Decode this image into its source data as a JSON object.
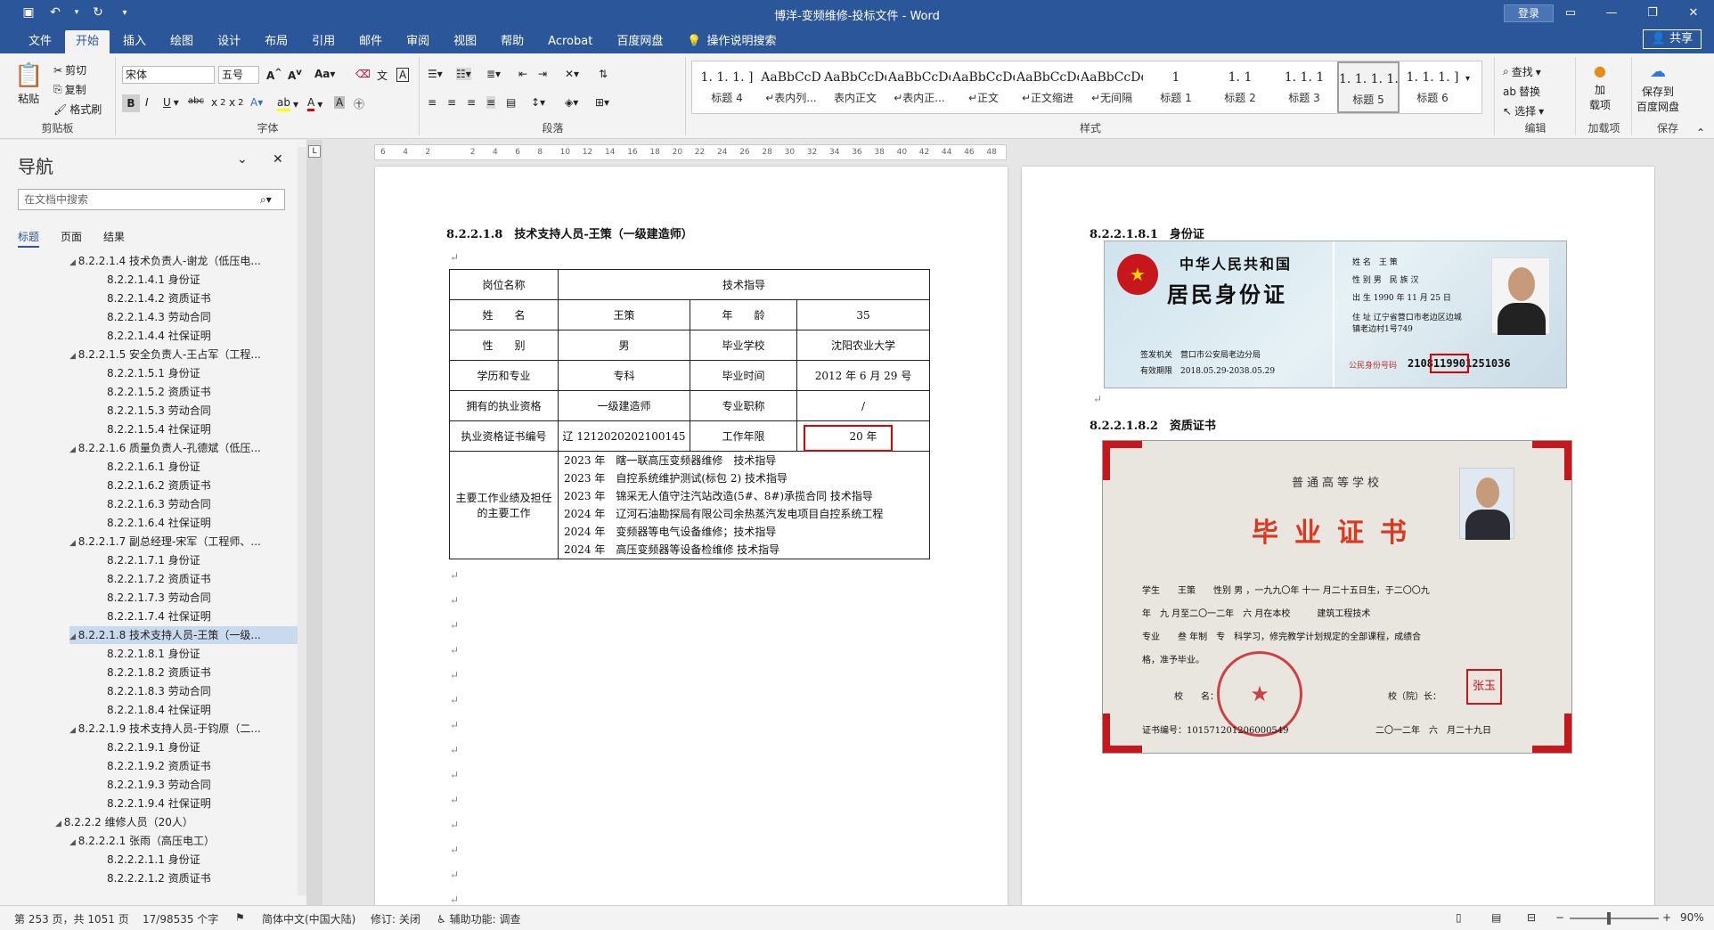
{
  "window": {
    "title": "博洋-变频维修-投标文件 - Word",
    "login": "登录",
    "share": "共享"
  },
  "tabs": [
    "文件",
    "开始",
    "插入",
    "绘图",
    "设计",
    "布局",
    "引用",
    "邮件",
    "审阅",
    "视图",
    "帮助",
    "Acrobat",
    "百度网盘",
    "操作说明搜索"
  ],
  "ribbon": {
    "clipboard": {
      "paste": "粘贴",
      "cut": "剪切",
      "copy": "复制",
      "painter": "格式刷",
      "label": "剪贴板"
    },
    "font": {
      "name": "宋体",
      "size": "五号",
      "label": "字体"
    },
    "paragraph": {
      "label": "段落"
    },
    "styles": {
      "label": "样式",
      "items": [
        {
          "preview": "1. 1. 1. ]",
          "name": "标题 4"
        },
        {
          "preview": "AaBbCcD",
          "name": "↵表内列..."
        },
        {
          "preview": "AaBbCcDdI",
          "name": "表内正文"
        },
        {
          "preview": "AaBbCcDdI",
          "name": "↵表内正..."
        },
        {
          "preview": "AaBbCcDdI",
          "name": "↵正文"
        },
        {
          "preview": "AaBbCcDdI",
          "name": "↵正文缩进"
        },
        {
          "preview": "AaBbCcDdI",
          "name": "↵无间隔"
        },
        {
          "preview": "1",
          "name": "标题 1"
        },
        {
          "preview": "Aa",
          "name": "标题 1"
        },
        {
          "preview": "1. 1",
          "name": "标题 2"
        },
        {
          "preview": "1. 1. 1",
          "name": "标题 3"
        },
        {
          "preview": "1. 1. 1. 1.",
          "name": "标题 5"
        },
        {
          "preview": "1. 1. 1. ]",
          "name": "标题 6"
        }
      ]
    },
    "editing": {
      "find": "查找",
      "replace": "替换",
      "select": "选择",
      "label": "编辑"
    },
    "addins": {
      "load": "加\n载项",
      "label": "加载项"
    },
    "baidu": {
      "save": "保存到\n百度网盘",
      "label": "保存"
    }
  },
  "nav": {
    "title": "导航",
    "search_placeholder": "在文档中搜索",
    "tabs": [
      "标题",
      "页面",
      "结果"
    ],
    "items": [
      {
        "text": "8.2.2.1.4 技术负责人-谢龙（低压电...",
        "level": 1,
        "arrow": true
      },
      {
        "text": "8.2.2.1.4.1 身份证",
        "level": 2
      },
      {
        "text": "8.2.2.1.4.2 资质证书",
        "level": 2
      },
      {
        "text": "8.2.2.1.4.3 劳动合同",
        "level": 2
      },
      {
        "text": "8.2.2.1.4.4 社保证明",
        "level": 2
      },
      {
        "text": "8.2.2.1.5 安全负责人-王占军（工程...",
        "level": 1,
        "arrow": true
      },
      {
        "text": "8.2.2.1.5.1 身份证",
        "level": 2
      },
      {
        "text": "8.2.2.1.5.2 资质证书",
        "level": 2
      },
      {
        "text": "8.2.2.1.5.3 劳动合同",
        "level": 2
      },
      {
        "text": "8.2.2.1.5.4 社保证明",
        "level": 2
      },
      {
        "text": "8.2.2.1.6 质量负责人-孔德斌（低压...",
        "level": 1,
        "arrow": true
      },
      {
        "text": "8.2.2.1.6.1 身份证",
        "level": 2
      },
      {
        "text": "8.2.2.1.6.2 资质证书",
        "level": 2
      },
      {
        "text": "8.2.2.1.6.3 劳动合同",
        "level": 2
      },
      {
        "text": "8.2.2.1.6.4 社保证明",
        "level": 2
      },
      {
        "text": "8.2.2.1.7 副总经理-宋军（工程师、...",
        "level": 1,
        "arrow": true
      },
      {
        "text": "8.2.2.1.7.1 身份证",
        "level": 2
      },
      {
        "text": "8.2.2.1.7.2 资质证书",
        "level": 2
      },
      {
        "text": "8.2.2.1.7.3 劳动合同",
        "level": 2
      },
      {
        "text": "8.2.2.1.7.4 社保证明",
        "level": 2
      },
      {
        "text": "8.2.2.1.8 技术支持人员-王策（一级...",
        "level": 1,
        "arrow": true,
        "selected": true
      },
      {
        "text": "8.2.2.1.8.1 身份证",
        "level": 2
      },
      {
        "text": "8.2.2.1.8.2 资质证书",
        "level": 2
      },
      {
        "text": "8.2.2.1.8.3 劳动合同",
        "level": 2
      },
      {
        "text": "8.2.2.1.8.4 社保证明",
        "level": 2
      },
      {
        "text": "8.2.2.1.9 技术支持人员-于钧原（二...",
        "level": 1,
        "arrow": true
      },
      {
        "text": "8.2.2.1.9.1 身份证",
        "level": 2
      },
      {
        "text": "8.2.2.1.9.2 资质证书",
        "level": 2
      },
      {
        "text": "8.2.2.1.9.3 劳动合同",
        "level": 2
      },
      {
        "text": "8.2.2.1.9.4 社保证明",
        "level": 2
      },
      {
        "text": "8.2.2.2 维修人员（20人）",
        "level": 0,
        "arrow": true
      },
      {
        "text": "8.2.2.2.1 张雨（高压电工）",
        "level": 1,
        "arrow": true
      },
      {
        "text": "8.2.2.2.1.1 身份证",
        "level": 2
      },
      {
        "text": "8.2.2.2.1.2 资质证书",
        "level": 2
      }
    ]
  },
  "ruler": {
    "ticks": [
      "6",
      "4",
      "2",
      "",
      "2",
      "4",
      "6",
      "8",
      "10",
      "12",
      "14",
      "16",
      "18",
      "20",
      "22",
      "24",
      "26",
      "28",
      "30",
      "32",
      "34",
      "36",
      "38",
      "40",
      "42",
      "44",
      "46",
      "48"
    ]
  },
  "page1": {
    "heading": "8.2.2.1.8　技术支持人员-王策（一级建造师）",
    "table": {
      "r1": [
        "岗位名称",
        "技术指导"
      ],
      "r2": [
        "姓　　名",
        "王策",
        "年　　龄",
        "35"
      ],
      "r3": [
        "性　　别",
        "男",
        "毕业学校",
        "沈阳农业大学"
      ],
      "r4": [
        "学历和专业",
        "专科",
        "毕业时间",
        "2012 年 6 月 29 号"
      ],
      "r5": [
        "拥有的执业资格",
        "一级建造师",
        "专业职称",
        "/"
      ],
      "r6": [
        "执业资格证书编号",
        "辽 1212020202100145",
        "工作年限",
        "20 年"
      ],
      "r7label": "主要工作业绩及担任的主要工作",
      "work": [
        "2023 年　瞎一联高压变频器维修　技术指导",
        "2023 年　自控系统维护测试(标包 2)  技术指导",
        "2023 年　锦采无人值守注汽站改造(5#、8#)承揽合同  技术指导",
        "2024 年　辽河石油勘探局有限公司余热蒸汽发电项目自控系统工程",
        "2024 年　变频器等电气设备维修；技术指导",
        "2024 年　高压变频器等设备检维修  技术指导"
      ]
    }
  },
  "page2": {
    "heading1": "8.2.2.1.8.1　身份证",
    "heading2": "8.2.2.1.8.2　资质证书",
    "idcard": {
      "front_title1": "中华人民共和国",
      "front_title2": "居民身份证",
      "authority_label": "签发机关",
      "authority": "营口市公安局老边分局",
      "valid_label": "有效期限",
      "valid": "2018.05.29-2038.05.29",
      "name_label": "姓 名",
      "name": "王 策",
      "sex_label": "性 别",
      "sex": "男",
      "nation_label": "民 族",
      "nation": "汉",
      "birth_label": "出 生",
      "birth": "1990 年 11 月 25 日",
      "addr_label": "住 址",
      "addr": "辽宁省营口市老边区边城镇老边村1号749",
      "id_label": "公民身份号码",
      "id_pre": "2108",
      "id_mid": "11990",
      "id_post": "1251036"
    },
    "cert": {
      "school": "普通高等学校",
      "title": "毕业证书",
      "line1": "学生　　王策　　性别 男 ，一九九〇年 十一 月二十五日生，于二〇〇九",
      "line2": "年　九 月至二〇一二年　六 月在本校　　　建筑工程技术",
      "line3": "专业　　叁 年制　专　科学习，修完教学计划规定的全部课程，成绩合",
      "line4": "格，准予毕业。",
      "head_label": "校　　名：",
      "president_label": "校（院）长：",
      "seal": "张玉",
      "no_label": "证书编号：",
      "no": "101571201206000549",
      "date": "二〇一二年　六　月二十九日"
    }
  },
  "status": {
    "page": "第 253 页，共 1051 页",
    "words": "17/98535 个字",
    "lang": "简体中文(中国大陆)",
    "track": "修订: 关闭",
    "access": "辅助功能: 调查",
    "zoom": "90%"
  }
}
